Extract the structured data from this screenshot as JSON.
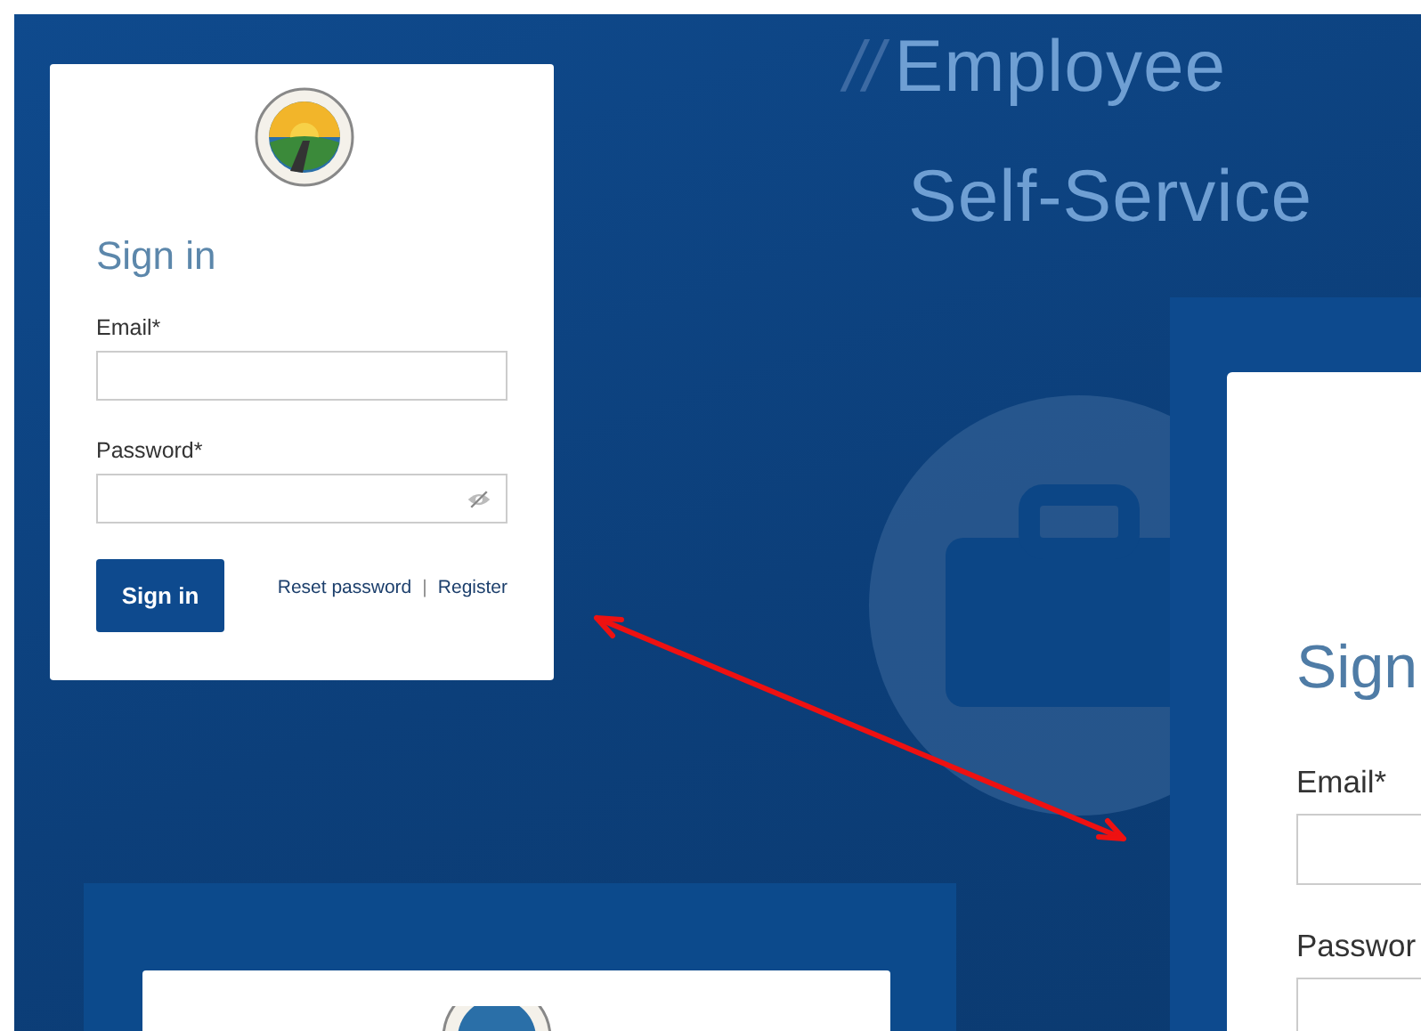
{
  "hero": {
    "slashes": "//",
    "line_1": "Employee",
    "line_2": "Self-Service"
  },
  "login_card": {
    "heading": "Sign in",
    "fields": [
      {
        "label": "Email*",
        "kind": "text"
      },
      {
        "label": "Password*",
        "kind": "password"
      }
    ],
    "button": "Sign in",
    "links": [
      "Reset password",
      "Register"
    ],
    "separator": "|"
  },
  "zoomed_card": {
    "heading": "Sign",
    "fields": [
      {
        "label": "Email*"
      },
      {
        "label": "Passwor"
      }
    ]
  }
}
